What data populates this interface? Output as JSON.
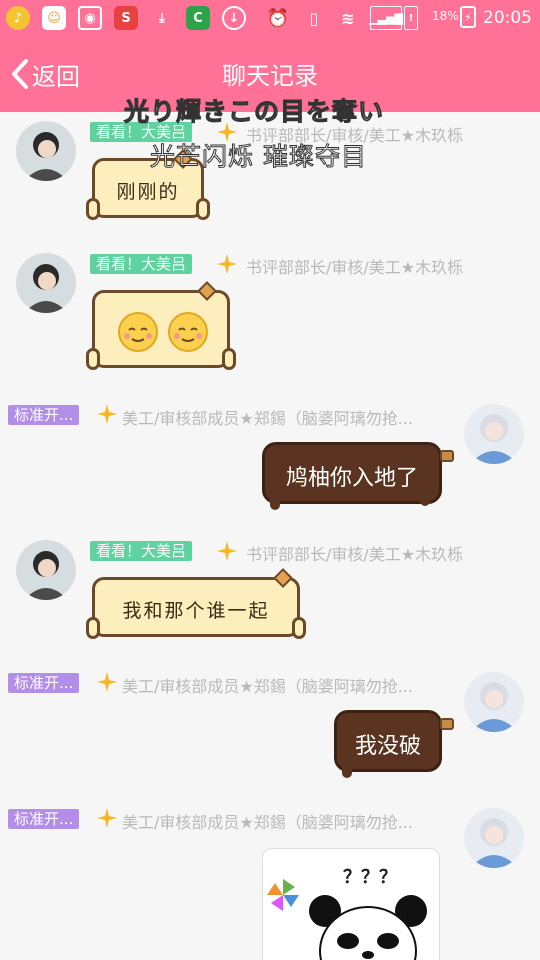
{
  "status_bar": {
    "battery_percent": "18%",
    "time": "20:05",
    "app_icons": [
      "music-icon",
      "face-app-icon",
      "screenshot-icon",
      "sogou-icon",
      "download-icon",
      "shield-app-icon",
      "download-circle-icon",
      "alarm-icon",
      "vibrate-icon",
      "wifi-icon",
      "signal-icon",
      "battery-icon"
    ]
  },
  "header": {
    "back_label": "返回",
    "title": "聊天记录"
  },
  "lyrics": {
    "line1_highlight": "光り輝きこの目",
    "line1_rest": "を奪い",
    "line2": "光芒闪烁 璀璨夺目"
  },
  "messages": [
    {
      "side": "left",
      "badge": "看看！大美吕",
      "name": "书评部部长/审核/美工★木玖栎",
      "text": "刚刚的",
      "bubble": "cat"
    },
    {
      "side": "left",
      "badge": "看看！大美吕",
      "name": "书评部部长/审核/美工★木玖栎",
      "text": "",
      "bubble": "cat-emoji"
    },
    {
      "side": "right",
      "badge": "标准开...",
      "name": "美工/审核部成员★郑錫（脑婆阿璃勿抢...",
      "text": "鸠柚你入地了",
      "bubble": "choco"
    },
    {
      "side": "left",
      "badge": "看看！大美吕",
      "name": "书评部部长/审核/美工★木玖栎",
      "text": "我和那个谁一起",
      "bubble": "cat"
    },
    {
      "side": "right",
      "badge": "标准开...",
      "name": "美工/审核部成员★郑錫（脑婆阿璃勿抢...",
      "text": "我没破",
      "bubble": "choco"
    },
    {
      "side": "right",
      "badge": "标准开...",
      "name": "美工/审核部成员★郑錫（脑婆阿璃勿抢...",
      "text": "",
      "bubble": "sticker",
      "sticker_text": "？？？"
    }
  ],
  "colors": {
    "brand_pink": "#ff7196",
    "badge_green": "#5ed3a0",
    "badge_purple": "#b28ee8",
    "lyric_highlight": "#3ee08a"
  }
}
